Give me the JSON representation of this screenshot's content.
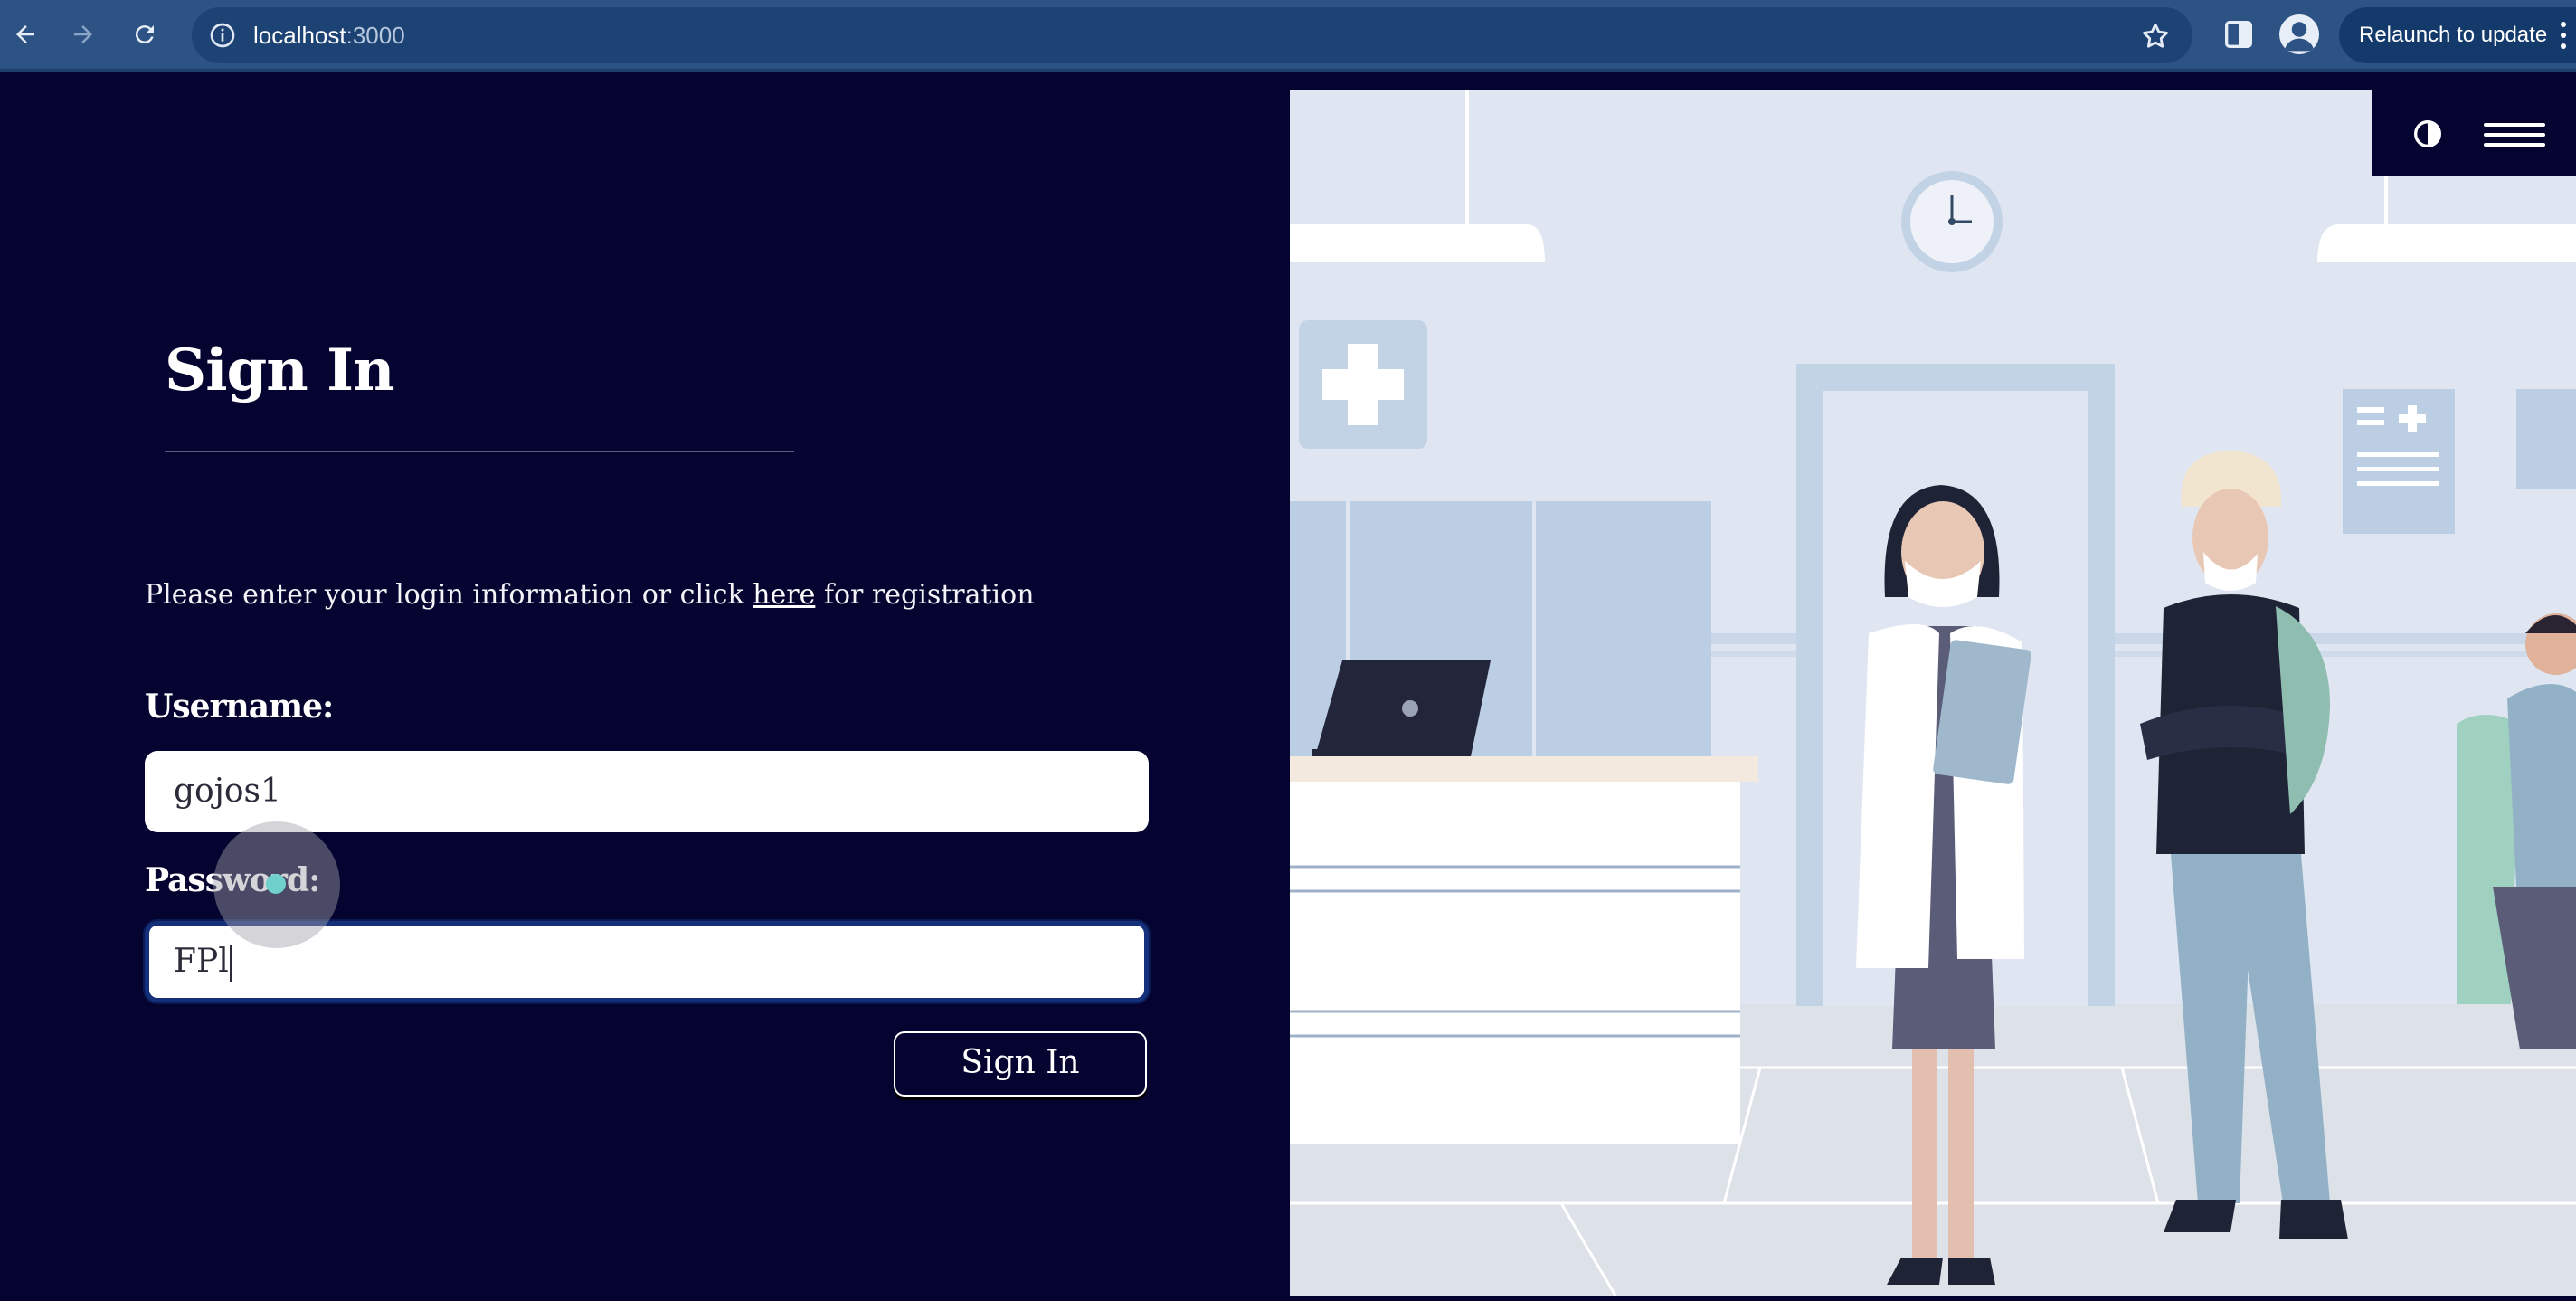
{
  "browser": {
    "url_host": "localhost",
    "url_port": ":3000",
    "relaunch_label": "Relaunch to update",
    "icons": [
      "back-icon",
      "forward-icon",
      "reload-icon",
      "site-info-icon",
      "star-icon",
      "side-panel-icon",
      "profile-icon",
      "kebab-menu-icon"
    ]
  },
  "login": {
    "title": "Sign In",
    "instruction_before": "Please enter your login information or click ",
    "instruction_link": "here",
    "instruction_after": " for registration",
    "username_label": "Username:",
    "username_value": "gojos1",
    "password_label": "Password:",
    "password_value": "FPl",
    "submit_label": "Sign In"
  },
  "header_controls": {
    "icons": [
      "contrast-icon",
      "hamburger-menu-icon"
    ]
  },
  "colors": {
    "page_bg": "#050430",
    "browser_bar": "#2d5284",
    "illustration_bg": "#dfe6f1"
  }
}
